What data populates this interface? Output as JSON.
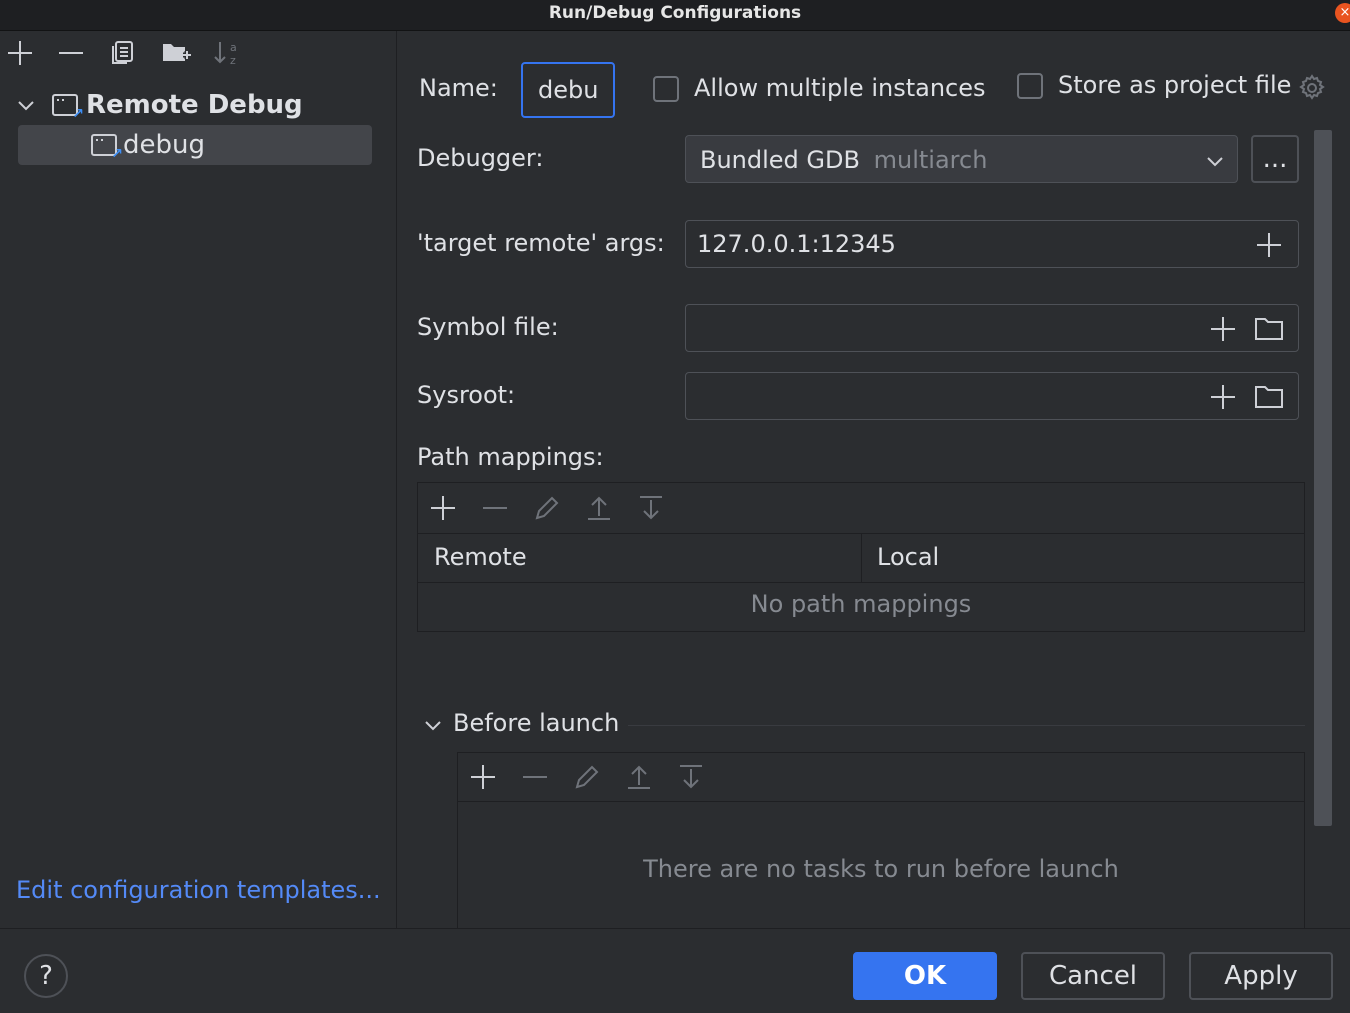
{
  "window": {
    "title": "Run/Debug Configurations",
    "close": "×"
  },
  "tree": {
    "group_label": "Remote Debug",
    "item_label": "debug"
  },
  "left_footer": {
    "templates_link": "Edit configuration templates..."
  },
  "form": {
    "name_label": "Name:",
    "name_value": "debu",
    "allow_multiple_label": "Allow multiple instances",
    "store_project_label": "Store as project file",
    "debugger_label": "Debugger:",
    "debugger_value": "Bundled GDB",
    "debugger_sub": "multiarch",
    "debugger_more": "...",
    "target_label": "'target remote' args:",
    "target_value": "127.0.0.1:12345",
    "symbol_label": "Symbol file:",
    "symbol_value": "",
    "sysroot_label": "Sysroot:",
    "sysroot_value": ""
  },
  "path_mappings": {
    "label": "Path mappings:",
    "columns": [
      "Remote",
      "Local"
    ],
    "empty_text": "No path mappings"
  },
  "before_launch": {
    "label": "Before launch",
    "empty_text": "There are no tasks to run before launch"
  },
  "footer": {
    "help": "?",
    "ok": "OK",
    "cancel": "Cancel",
    "apply": "Apply"
  },
  "colors": {
    "accent": "#3574f0",
    "link": "#548af7",
    "background": "#2b2d30"
  }
}
